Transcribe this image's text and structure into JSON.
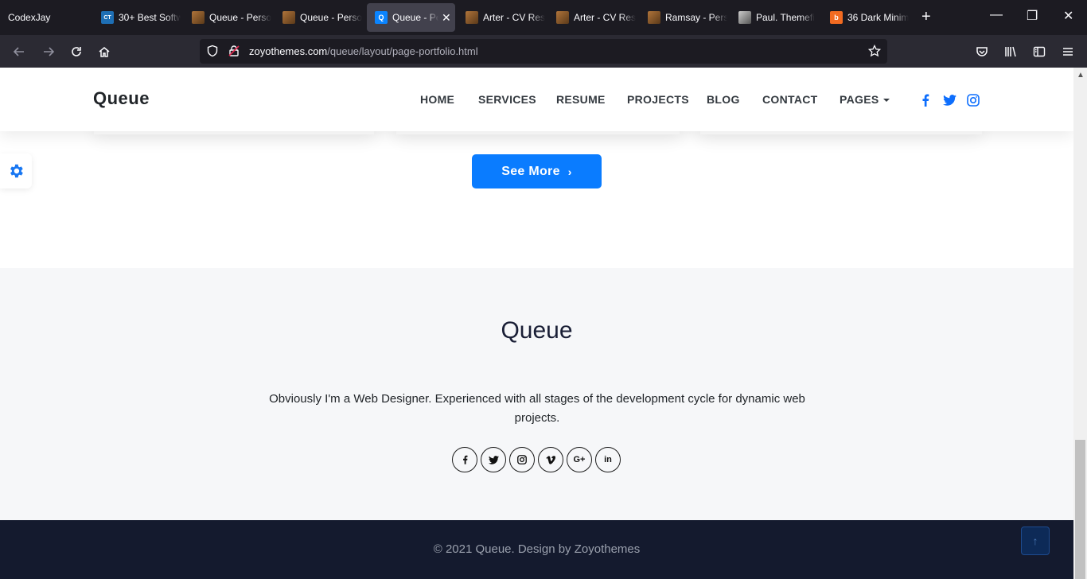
{
  "browser": {
    "profile": "CodexJay",
    "tabs": [
      {
        "title": "30+ Best Softw",
        "favicon_text": "CT"
      },
      {
        "title": "Queue - Perso"
      },
      {
        "title": "Queue - Perso"
      },
      {
        "title": "Queue - Pe",
        "favicon_text": "Q",
        "active": true
      },
      {
        "title": "Arter - CV Res"
      },
      {
        "title": "Arter - CV Res"
      },
      {
        "title": "Ramsay - Pers"
      },
      {
        "title": "Paul. Themefi"
      },
      {
        "title": "36 Dark Minim"
      }
    ],
    "url_host": "zoyothemes.com",
    "url_path": "/queue/layout/page-portfolio.html"
  },
  "site": {
    "logo": "Queue",
    "nav": {
      "home": "HOME",
      "services": "SERVICES",
      "resume": "RESUME",
      "projects": "PROJECTS",
      "blog": "BLOG",
      "contact": "CONTACT",
      "pages": "PAGES"
    },
    "see_more": "See More",
    "footer": {
      "logo": "Queue",
      "description": "Obviously I'm a Web Designer. Experienced with all stages of the development cycle for dynamic web projects.",
      "copyright": "© 2021 Queue. Design by Zoyothemes"
    }
  },
  "colors": {
    "accent": "#0a7cff",
    "footer_bottom": "#141a2e",
    "footer_top": "#f6f7f9",
    "browser_chrome": "#1c1b22"
  },
  "icons": [
    "facebook-icon",
    "twitter-icon",
    "instagram-icon",
    "vimeo-icon",
    "google-plus-icon",
    "linkedin-icon",
    "gear-icon",
    "arrow-up-icon"
  ]
}
